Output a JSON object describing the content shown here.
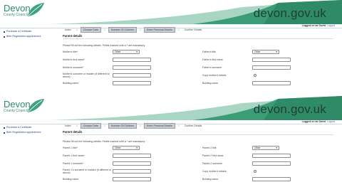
{
  "panels": [
    {
      "header": {
        "logo_title": "Devon",
        "logo_subtitle": "County Council",
        "domain": "devon.gov.uk"
      },
      "login": {
        "status": "Logged on as Guest",
        "logout": "Logout"
      },
      "sidebar": {
        "items": [
          "Purchase a Certificate",
          "Birth Registration appointment"
        ]
      },
      "steps": [
        "Index",
        "Choose Date",
        "Number Of Children",
        "Enter Personal Details",
        "Confirm Details"
      ],
      "active_step": 3,
      "section_title": "Parent details",
      "intro": "Please fill out the following details. Fields marked with a * are mandatory.",
      "left_fields": [
        {
          "label": "Mother's title*",
          "type": "select",
          "value": "Other"
        },
        {
          "label": "Mother's first name*",
          "type": "text"
        },
        {
          "label": "Mother's surname*",
          "type": "text"
        },
        {
          "label": "Mother's surname or maiden (if different to above)",
          "type": "text"
        },
        {
          "label": "Building name",
          "type": "text"
        }
      ],
      "right_fields": [
        {
          "label": "Father's title",
          "type": "select",
          "value": "Other"
        },
        {
          "label": "Father's first name",
          "type": "text"
        },
        {
          "label": "Father's surname",
          "type": "text"
        },
        {
          "label": "Copy mother's details",
          "type": "checkbox"
        },
        {
          "label": "Building name",
          "type": "text"
        }
      ]
    },
    {
      "header": {
        "logo_title": "Devon",
        "logo_subtitle": "County Council",
        "domain": "devon.gov.uk"
      },
      "login": {
        "status": "Logged on as Guest",
        "logout": "Logout"
      },
      "sidebar": {
        "items": [
          "Purchase a Certificate",
          "Birth Registration appointment"
        ]
      },
      "steps": [
        "Index",
        "Choose Date",
        "Number Of Children",
        "Enter Personal Details",
        "Confirm Details"
      ],
      "active_step": 3,
      "section_title": "Parent details",
      "intro": "Please fill out the following details. Fields marked with a * are mandatory.",
      "left_fields": [
        {
          "label": "Parent 1 title*",
          "type": "select",
          "value": "Other"
        },
        {
          "label": "Parent 1 first name*",
          "type": "text"
        },
        {
          "label": "Parent 1 surname*",
          "type": "text"
        },
        {
          "label": "Parent 1's surname or maiden (if different to above)",
          "type": "text"
        },
        {
          "label": "Building name",
          "type": "text"
        }
      ],
      "right_fields": [
        {
          "label": "Parent 2 title",
          "type": "select",
          "value": "Other"
        },
        {
          "label": "Parent 2 first name",
          "type": "text"
        },
        {
          "label": "Parent 2 surname",
          "type": "text"
        },
        {
          "label": "Copy mother's details",
          "type": "checkbox"
        },
        {
          "label": "Building name",
          "type": "text"
        }
      ]
    }
  ],
  "colors": {
    "brand_green": "#2e8b6e",
    "banner_dark": "#1d3f3a",
    "link_blue": "#2a3f8f"
  }
}
